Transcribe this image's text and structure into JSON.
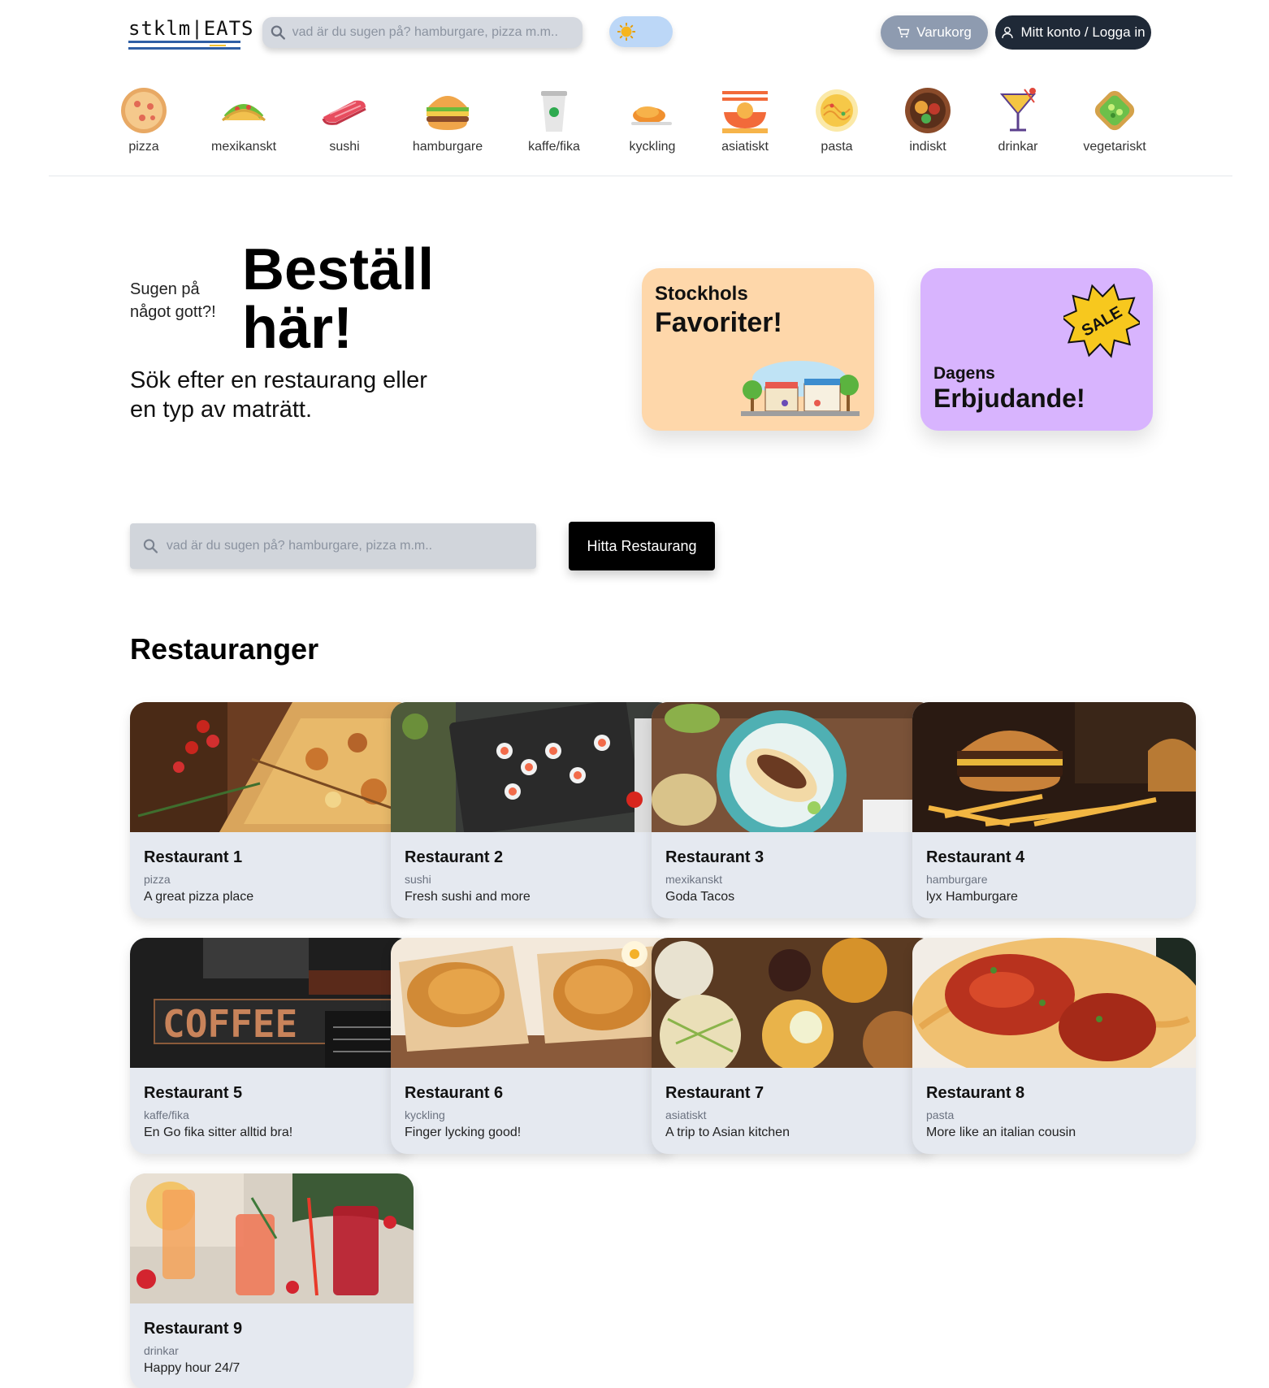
{
  "logo": {
    "text": "stklm|EATS"
  },
  "header": {
    "search_placeholder": "vad är du sugen på? hamburgare, pizza m.m..",
    "cart_label": "Varukorg",
    "account_label": "Mitt konto / Logga in"
  },
  "categories": [
    {
      "label": "pizza",
      "icon": "pizza-icon"
    },
    {
      "label": "mexikanskt",
      "icon": "taco-icon"
    },
    {
      "label": "sushi",
      "icon": "sushi-icon"
    },
    {
      "label": "hamburgare",
      "icon": "burger-icon"
    },
    {
      "label": "kaffe/fika",
      "icon": "coffee-cup-icon"
    },
    {
      "label": "kyckling",
      "icon": "chicken-icon"
    },
    {
      "label": "asiatiskt",
      "icon": "noodle-icon"
    },
    {
      "label": "pasta",
      "icon": "pasta-bowl-icon"
    },
    {
      "label": "indiskt",
      "icon": "curry-bowl-icon"
    },
    {
      "label": "drinkar",
      "icon": "cocktail-icon"
    },
    {
      "label": "vegetariskt",
      "icon": "salad-icon"
    }
  ],
  "hero": {
    "small": "Sugen på något gott?!",
    "big": "Beställ här!",
    "sub": "Sök efter en restaurang eller en typ av maträtt.",
    "search_placeholder": "vad är du sugen på? hamburgare, pizza m.m..",
    "find_button": "Hitta Restaurang"
  },
  "promos": {
    "favorites": {
      "small": "Stockhols",
      "big": "Favoriter!"
    },
    "deal": {
      "small": "Dagens",
      "big": "Erbjudande!",
      "badge": "SALE"
    }
  },
  "restaurants": {
    "title": "Restauranger",
    "items": [
      {
        "name": "Restaurant 1",
        "category": "pizza",
        "description": "A great pizza place"
      },
      {
        "name": "Restaurant 2",
        "category": "sushi",
        "description": "Fresh sushi and more"
      },
      {
        "name": "Restaurant 3",
        "category": "mexikanskt",
        "description": "Goda Tacos"
      },
      {
        "name": "Restaurant 4",
        "category": "hamburgare",
        "description": "lyx Hamburgare"
      },
      {
        "name": "Restaurant 5",
        "category": "kaffe/fika",
        "description": "En Go fika sitter alltid bra!"
      },
      {
        "name": "Restaurant 6",
        "category": "kyckling",
        "description": "Finger lycking good!"
      },
      {
        "name": "Restaurant 7",
        "category": "asiatiskt",
        "description": "A trip to Asian kitchen"
      },
      {
        "name": "Restaurant 8",
        "category": "pasta",
        "description": "More like an italian cousin"
      },
      {
        "name": "Restaurant 9",
        "category": "drinkar",
        "description": "Happy hour 24/7"
      }
    ]
  },
  "photo_signage": {
    "coffee": "COFFEE"
  },
  "colors": {
    "cart_button": "#8e9bb0",
    "account_button": "#1f2937",
    "favorites_card": "#fed7aa",
    "deal_card": "#d8b4fe",
    "card_bg": "#e5e9f0",
    "find_button": "#000000"
  }
}
